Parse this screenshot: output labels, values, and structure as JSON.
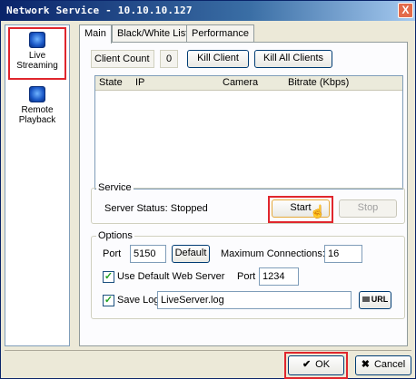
{
  "window": {
    "title": "Network Service - 10.10.10.127",
    "close_symbol": "X"
  },
  "sidebar": {
    "items": [
      {
        "label": "Live Streaming",
        "icon": "camera-icon",
        "selected": true
      },
      {
        "label": "Remote Playback",
        "icon": "playback-icon",
        "selected": false
      }
    ]
  },
  "tabs": [
    {
      "label": "Main",
      "active": true
    },
    {
      "label": "Black/White List",
      "active": false
    },
    {
      "label": "Performance",
      "active": false
    }
  ],
  "client": {
    "count_label": "Client Count",
    "count_value": "0",
    "kill_client": "Kill Client",
    "kill_all_clients": "Kill All Clients"
  },
  "client_list": {
    "columns": [
      "State",
      "IP",
      "Camera",
      "Bitrate (Kbps)"
    ],
    "rows": []
  },
  "service": {
    "legend": "Service",
    "status_text": "Server Status: Stopped",
    "start_label": "Start",
    "stop_label": "Stop"
  },
  "options": {
    "legend": "Options",
    "port_label": "Port",
    "port_value": "5150",
    "default_label": "Default",
    "max_connections_label": "Maximum Connections:",
    "max_connections_value": "16",
    "use_default_web_server_label": "Use Default Web Server",
    "use_default_web_server_checked": true,
    "web_port_label": "Port",
    "web_port_value": "1234",
    "save_log_label": "Save Log",
    "save_log_checked": true,
    "log_file_value": "LiveServer.log",
    "browse_label": "URL"
  },
  "footer": {
    "ok_label": "OK",
    "cancel_label": "Cancel"
  },
  "colors": {
    "highlight": "#e0262d",
    "title_bar": "#0a246a"
  }
}
